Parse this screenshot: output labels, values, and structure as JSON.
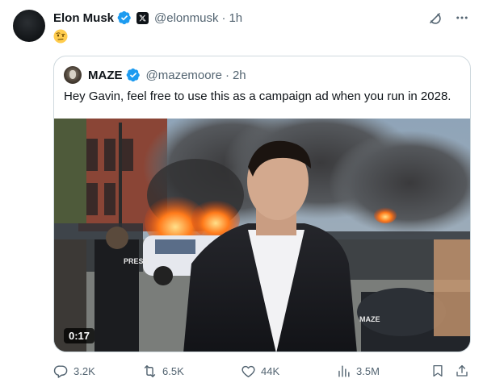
{
  "author": {
    "name": "Elon Musk",
    "handle": "@elonmusk",
    "time": "1h",
    "verified_color": "#1d9bf0",
    "affiliate_badge": "x-logo"
  },
  "post": {
    "emoji": "face-with-raised-eyebrow"
  },
  "quoted": {
    "name": "MAZE",
    "handle": "@mazemoore",
    "time": "2h",
    "text": "Hey Gavin, feel free to use this as a campaign ad when you run in 2028.",
    "media": {
      "duration": "0:17",
      "vest_label": "PRESS",
      "cap_label": "MAZE"
    }
  },
  "actions": {
    "replies": "3.2K",
    "reposts": "6.5K",
    "likes": "44K",
    "views": "3.5M"
  },
  "colors": {
    "text": "#0f1419",
    "secondary": "#536471",
    "border": "#cfd9de",
    "accent": "#1d9bf0"
  }
}
